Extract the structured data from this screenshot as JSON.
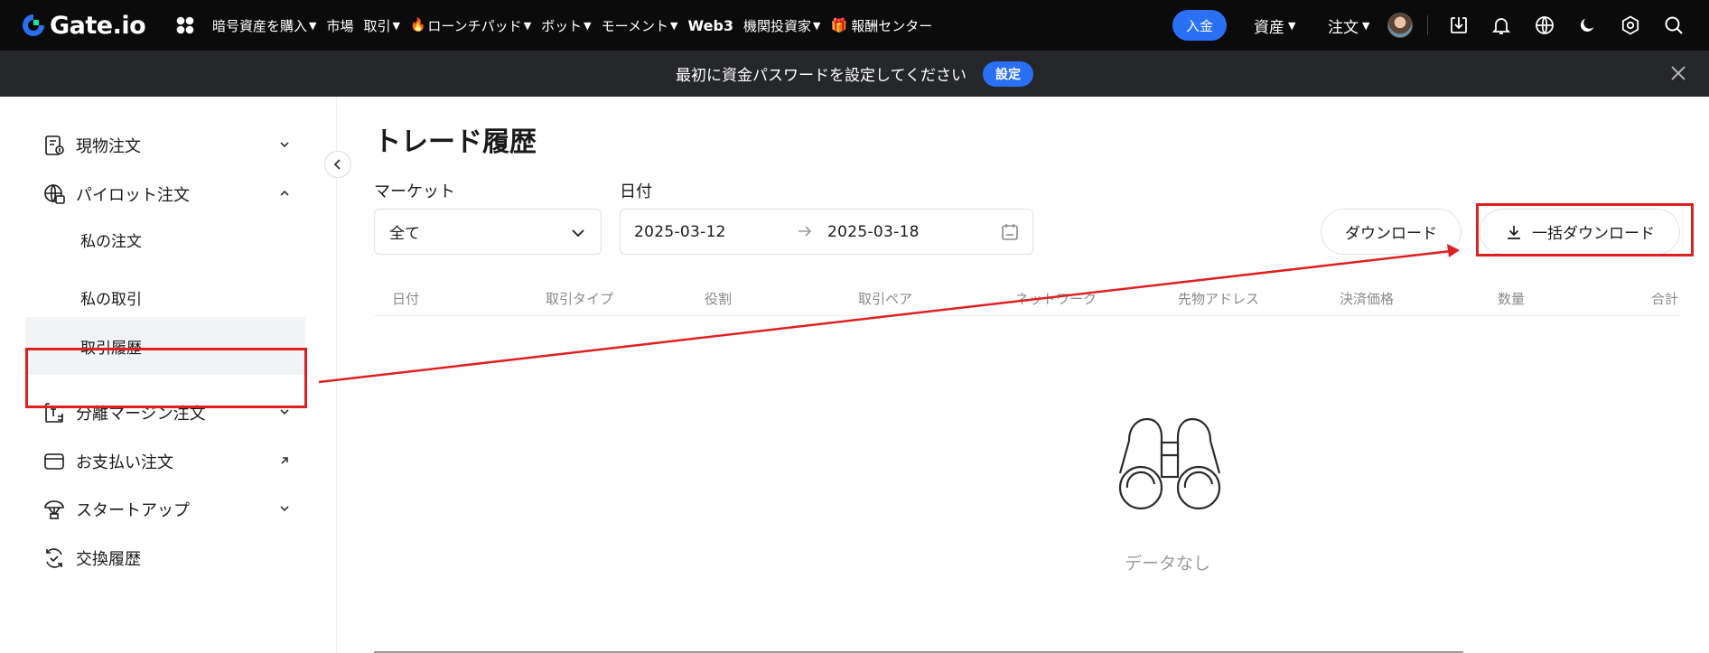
{
  "header": {
    "logo_text": "Gate.io",
    "nav": [
      {
        "label": "暗号資産を購入",
        "caret": true
      },
      {
        "label": "市場",
        "caret": false
      },
      {
        "label": "取引",
        "caret": true
      },
      {
        "label": "ローンチパッド",
        "caret": true,
        "fire": true
      },
      {
        "label": "ボット",
        "caret": true
      },
      {
        "label": "モーメント",
        "caret": true
      },
      {
        "label": "Web3",
        "caret": false,
        "bold": true
      },
      {
        "label": "機関投資家",
        "caret": true
      },
      {
        "label": "報酬センター",
        "caret": false,
        "gift": true
      }
    ],
    "deposit_label": "入金",
    "assets_label": "資産",
    "orders_label": "注文"
  },
  "notice": {
    "text": "最初に資金パスワードを設定してください",
    "button_label": "設定"
  },
  "sidebar": {
    "items": [
      {
        "label": "現物注文",
        "icon": "spot-order-icon",
        "chevron": "down"
      },
      {
        "label": "パイロット注文",
        "icon": "globe-order-icon",
        "chevron": "up"
      },
      {
        "label": "私の注文",
        "sub": true
      },
      {
        "label": "私の取引",
        "sub": true
      },
      {
        "label": "取引履歴",
        "sub": true,
        "active": true
      },
      {
        "label": "分離マージン注文",
        "icon": "margin-order-icon",
        "chevron": "down"
      },
      {
        "label": "お支払い注文",
        "icon": "card-icon",
        "chevron": "external"
      },
      {
        "label": "スタートアップ",
        "icon": "startup-icon",
        "chevron": "down"
      },
      {
        "label": "交換履歴",
        "icon": "exchange-icon",
        "chevron": "none"
      }
    ]
  },
  "main": {
    "title": "トレード履歴",
    "market_label": "マーケット",
    "market_value": "全て",
    "date_label": "日付",
    "date_start": "2025-03-12",
    "date_end": "2025-03-18",
    "download_label": "ダウンロード",
    "bulk_download_label": "一括ダウンロード",
    "columns": [
      "日付",
      "取引タイプ",
      "役割",
      "取引ペア",
      "ネットワーク",
      "先物アドレス",
      "決済価格",
      "数量",
      "合計"
    ],
    "empty_text": "データなし"
  },
  "colors": {
    "accent": "#2a70f5",
    "annotation": "#e02020",
    "header_bg": "#0b0b0c",
    "notice_bg": "#26272b"
  }
}
